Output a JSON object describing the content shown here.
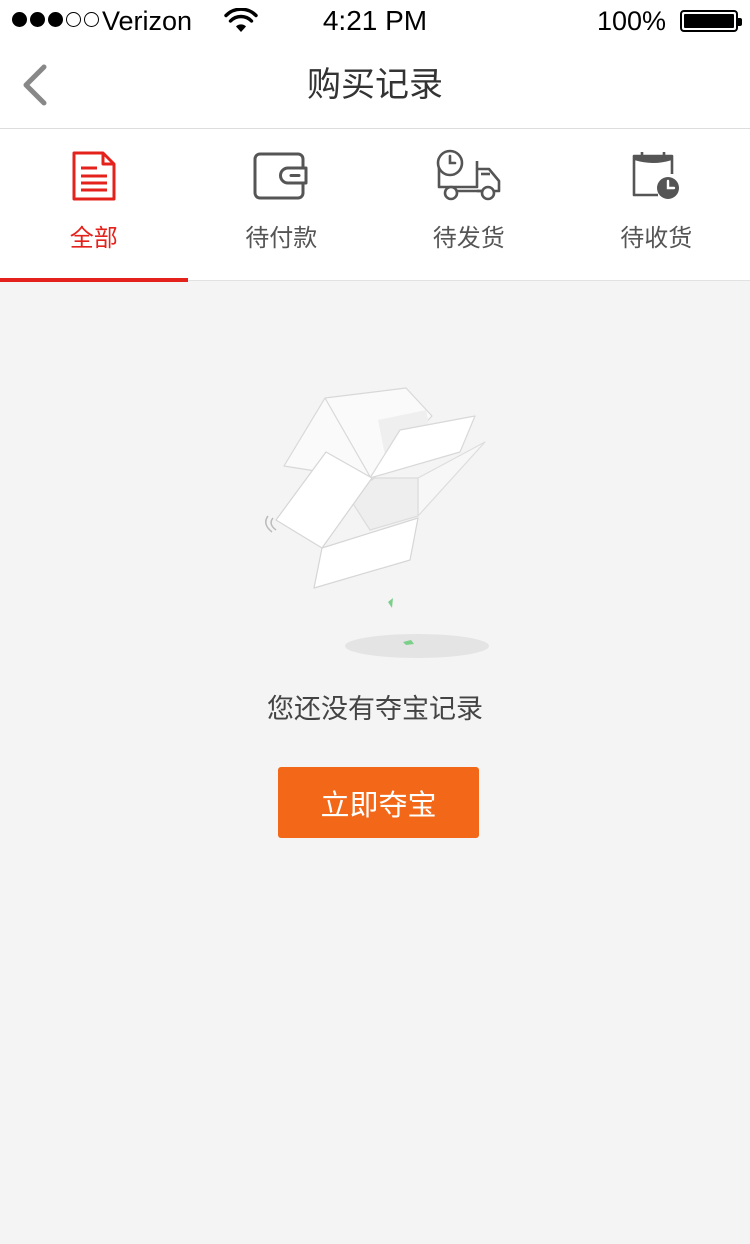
{
  "status_bar": {
    "carrier": "Verizon",
    "time": "4:21 PM",
    "battery": "100%",
    "signal_strength": 3,
    "signal_max": 5
  },
  "nav": {
    "title": "购买记录",
    "back_icon": "chevron-left-icon"
  },
  "tabs": [
    {
      "id": "all",
      "label": "全部",
      "icon": "document-icon",
      "active": true
    },
    {
      "id": "pending-payment",
      "label": "待付款",
      "icon": "wallet-icon",
      "active": false
    },
    {
      "id": "pending-shipment",
      "label": "待发货",
      "icon": "delivery-truck-icon",
      "active": false
    },
    {
      "id": "pending-receipt",
      "label": "待收货",
      "icon": "calendar-clock-icon",
      "active": false
    }
  ],
  "empty_state": {
    "illustration": "open-box-icon",
    "message": "您还没有夺宝记录",
    "button_label": "立即夺宝"
  },
  "colors": {
    "accent_red": "#e5211b",
    "button_orange": "#f26818",
    "background": "#f4f4f4",
    "icon_gray": "#555555"
  }
}
